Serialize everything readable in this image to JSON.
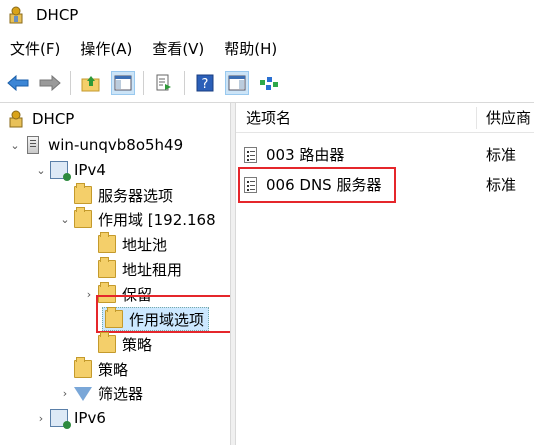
{
  "window": {
    "title": "DHCP",
    "icon": "dhcp-app-icon"
  },
  "menu": {
    "items": [
      "文件(F)",
      "操作(A)",
      "查看(V)",
      "帮助(H)"
    ]
  },
  "toolbar": {
    "buttons": [
      "back-arrow-icon",
      "forward-arrow-icon",
      "up-folder-icon",
      "show-hide-tree-icon",
      "export-list-icon",
      "help-icon",
      "action-pane-icon",
      "dhcp-filter-icon"
    ]
  },
  "tree": {
    "root": "DHCP",
    "server": "win-unqvb8o5h49",
    "ipv4": "IPv4",
    "server_options": "服务器选项",
    "scope": "作用域 [192.168",
    "address_pool": "地址池",
    "address_leases": "地址租用",
    "reservations": "保留",
    "scope_options": "作用域选项",
    "scope_policies": "策略",
    "policies": "策略",
    "filters": "筛选器",
    "ipv6": "IPv6"
  },
  "list": {
    "columns": [
      "选项名",
      "供应商"
    ],
    "rows": [
      {
        "name": "003 路由器",
        "vendor": "标准"
      },
      {
        "name": "006 DNS 服务器",
        "vendor": "标准"
      }
    ]
  },
  "colors": {
    "highlight_box": "#e5262b",
    "selection": "#cce8ff",
    "accent_blue": "#1a6fc4"
  }
}
